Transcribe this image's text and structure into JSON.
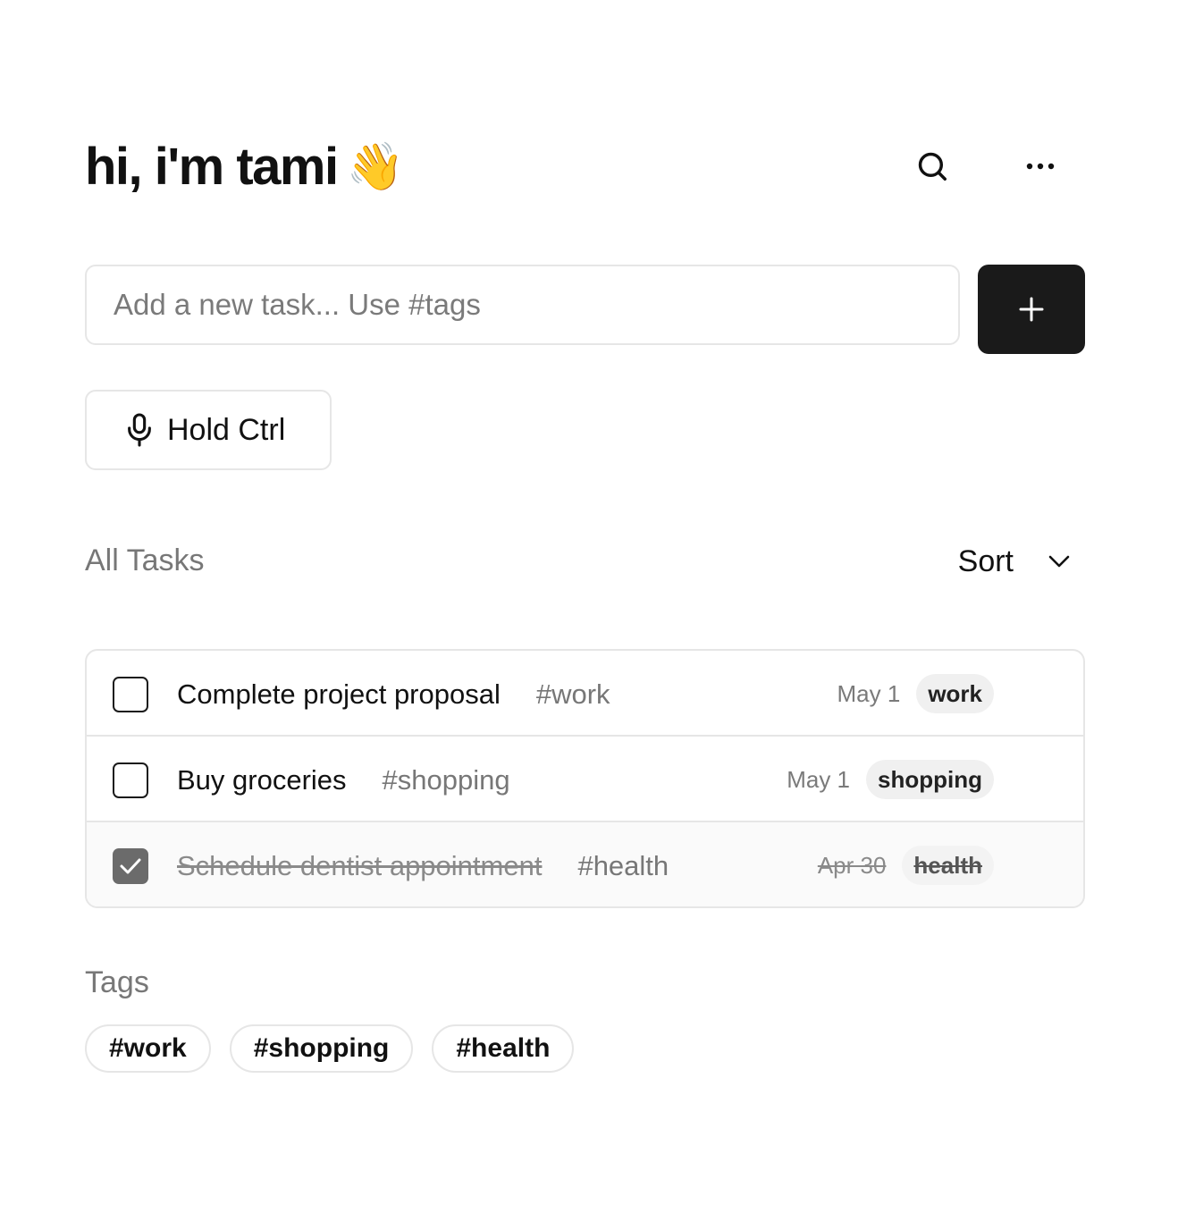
{
  "header": {
    "title": "hi, i'm tami",
    "emoji": "👋",
    "search_icon": "search-icon",
    "more_icon": "more-horizontal-icon"
  },
  "composer": {
    "placeholder": "Add a new task... Use #tags",
    "value": "",
    "add_icon": "plus-icon"
  },
  "voice": {
    "label": "Hold Ctrl",
    "icon": "microphone-icon"
  },
  "tasks_section": {
    "title": "All Tasks",
    "sort_label": "Sort",
    "sort_icon": "chevron-down-icon"
  },
  "tasks": [
    {
      "name": "Complete project proposal",
      "tag_inline": "#work",
      "date": "May 1",
      "chip": "work",
      "done": false
    },
    {
      "name": "Buy groceries",
      "tag_inline": "#shopping",
      "date": "May 1",
      "chip": "shopping",
      "done": false
    },
    {
      "name": "Schedule dentist appointment",
      "tag_inline": "#health",
      "date": "Apr 30",
      "chip": "health",
      "done": true
    }
  ],
  "tags_section": {
    "title": "Tags",
    "tags": [
      "#work",
      "#shopping",
      "#health"
    ]
  },
  "colors": {
    "accent": "#1a1a1a",
    "muted_text": "#777777",
    "border": "#e6e6e6",
    "chip_bg": "#f0f0f0",
    "checked_box": "#6b6b6b"
  }
}
